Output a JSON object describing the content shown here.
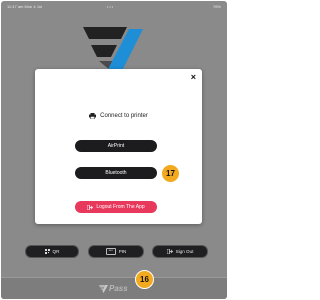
{
  "status_bar": {
    "time": "11:47 am  Mon 4 Jul",
    "dots": "•••",
    "battery": "76%"
  },
  "main": {
    "buttons": {
      "qr": {
        "label": "QR",
        "icon": "qr-icon"
      },
      "pin": {
        "label": "PIN",
        "dots": "***",
        "icon": "pin-icon"
      },
      "sign_out": {
        "label": "Sign Out",
        "icon": "sign-out-icon"
      }
    }
  },
  "footer": {
    "brand": "Pass"
  },
  "badges": {
    "footer": "16",
    "bluetooth": "17"
  },
  "modal": {
    "title": "Connect to printer",
    "close_label": "×",
    "airprint_label": "AirPrint",
    "bluetooth_label": "Bluetooth",
    "logout_label": "Logout From The App"
  },
  "colors": {
    "backdrop": "#8a8a8a",
    "logo_accent": "#1e8fd6",
    "logout_button": "#e8395c",
    "badge": "#f2a91e",
    "dark_button": "#1c1c1f"
  }
}
